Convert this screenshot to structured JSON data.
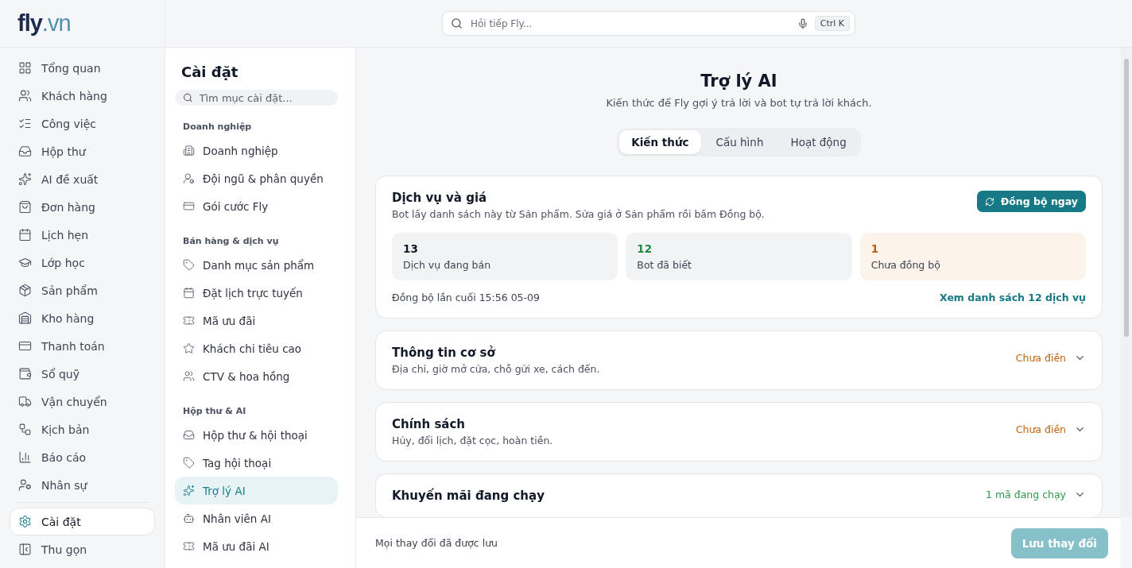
{
  "logo": {
    "brand": "fly",
    "suffix": ".vn"
  },
  "search": {
    "placeholder": "Hỏi tiếp Fly...",
    "shortcut": "Ctrl K"
  },
  "nav": {
    "items": [
      {
        "label": "Tổng quan",
        "selected": false
      },
      {
        "label": "Khách hàng",
        "selected": false
      },
      {
        "label": "Công việc",
        "selected": false
      },
      {
        "label": "Hộp thư",
        "selected": false
      },
      {
        "label": "AI đề xuất",
        "selected": false
      },
      {
        "label": "Đơn hàng",
        "selected": false
      },
      {
        "label": "Lịch hẹn",
        "selected": false
      },
      {
        "label": "Lớp học",
        "selected": false
      },
      {
        "label": "Sản phẩm",
        "selected": false
      },
      {
        "label": "Kho hàng",
        "selected": false
      },
      {
        "label": "Thanh toán",
        "selected": false
      },
      {
        "label": "Sổ quỹ",
        "selected": false
      },
      {
        "label": "Vận chuyển",
        "selected": false
      },
      {
        "label": "Kịch bản",
        "selected": false
      },
      {
        "label": "Báo cáo",
        "selected": false
      },
      {
        "label": "Nhân sự",
        "selected": false
      }
    ],
    "settings": {
      "label": "Cài đặt",
      "selected": true
    },
    "collapse": "Thu gọn"
  },
  "settings_panel": {
    "title": "Cài đặt",
    "search_placeholder": "Tìm mục cài đặt...",
    "sections": [
      {
        "heading": "Doanh nghiệp",
        "items": [
          {
            "label": "Doanh nghiệp",
            "selected": false
          },
          {
            "label": "Đội ngũ & phân quyền",
            "selected": false
          },
          {
            "label": "Gói cước Fly",
            "selected": false
          }
        ]
      },
      {
        "heading": "Bán hàng & dịch vụ",
        "items": [
          {
            "label": "Danh mục sản phẩm",
            "selected": false
          },
          {
            "label": "Đặt lịch trực tuyến",
            "selected": false
          },
          {
            "label": "Mã ưu đãi",
            "selected": false
          },
          {
            "label": "Khách chi tiêu cao",
            "selected": false
          },
          {
            "label": "CTV & hoa hồng",
            "selected": false
          }
        ]
      },
      {
        "heading": "Hộp thư & AI",
        "items": [
          {
            "label": "Hộp thư & hội thoại",
            "selected": false
          },
          {
            "label": "Tag hội thoại",
            "selected": false
          },
          {
            "label": "Trợ lý AI",
            "selected": true
          },
          {
            "label": "Nhân viên AI",
            "selected": false
          },
          {
            "label": "Mã ưu đãi AI",
            "selected": false
          }
        ]
      }
    ]
  },
  "page": {
    "title": "Trợ lý AI",
    "subtitle": "Kiến thức để Fly gợi ý trả lời và bot tự trả lời khách.",
    "tabs": [
      {
        "label": "Kiến thức",
        "selected": true
      },
      {
        "label": "Cấu hình",
        "selected": false
      },
      {
        "label": "Hoạt động",
        "selected": false
      }
    ]
  },
  "services": {
    "title": "Dịch vụ và giá",
    "description": "Bot lấy danh sách này từ Sản phẩm. Sửa giá ở Sản phẩm rồi bấm Đồng bộ.",
    "sync_button": "Đồng bộ ngay",
    "stats": [
      {
        "value": "13",
        "label": "Dịch vụ đang bán",
        "kind": "neutral"
      },
      {
        "value": "12",
        "label": "Bot đã biết",
        "kind": "success"
      },
      {
        "value": "1",
        "label": "Chưa đồng bộ",
        "kind": "warning"
      }
    ],
    "last_sync": "Đồng bộ lần cuối 15:56 05-09",
    "link": "Xem danh sách 12 dịch vụ"
  },
  "sections": [
    {
      "title": "Thông tin cơ sở",
      "description": "Địa chỉ, giờ mở cửa, chỗ gửi xe, cách đến.",
      "status": "Chưa điền",
      "color": "#c2620a",
      "expanded": false
    },
    {
      "title": "Chính sách",
      "description": "Hủy, đổi lịch, đặt cọc, hoàn tiền.",
      "status": "Chưa điền",
      "color": "#c2620a",
      "expanded": false
    },
    {
      "title": "Khuyến mãi đang chạy",
      "status": "1 mã đang chạy",
      "color": "#2f9a4a",
      "expanded": false
    }
  ],
  "footer": {
    "status": "Mọi thay đổi đã được lưu",
    "save_button": "Lưu thay đổi",
    "disabled": true
  }
}
